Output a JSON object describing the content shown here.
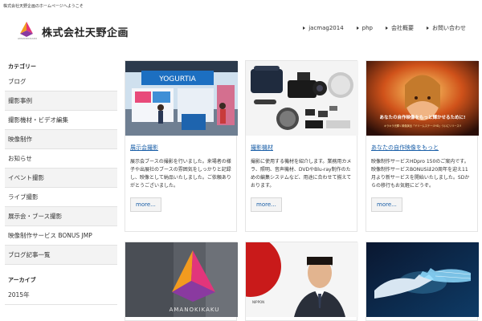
{
  "top_tagline": "株式会社天野企画のホームページへようこそ",
  "logo": {
    "small_text": "AMANOKIKAKU",
    "text": "株式会社天野企画"
  },
  "nav": [
    {
      "label": "jacmag2014"
    },
    {
      "label": "php"
    },
    {
      "label": "会社概要"
    },
    {
      "label": "お問い合わせ"
    }
  ],
  "sidebar": {
    "heading1": "カテゴリー",
    "items": [
      {
        "label": "ブログ"
      },
      {
        "label": "撮影事例"
      },
      {
        "label": "撮影機材・ビデオ編集"
      },
      {
        "label": "映像制作"
      },
      {
        "label": "お知らせ"
      },
      {
        "label": "イベント撮影"
      },
      {
        "label": "ライブ撮影"
      },
      {
        "label": "展示会・ブース撮影"
      },
      {
        "label": "映像制作サービス BONUS JMP"
      },
      {
        "label": "ブログ記事一覧"
      }
    ],
    "heading2": "アーカイブ",
    "items2": [
      {
        "label": "2015年"
      }
    ]
  },
  "cards": [
    {
      "title": "展示会撮影",
      "excerpt": "展示会ブースの撮影を行いました。来場者の様子や出展社のブースの雰囲気をしっかりと記録し、映像として納品いたしました。ご依頼ありがとうございました。",
      "more": "more..."
    },
    {
      "title": "撮影機材",
      "excerpt": "撮影に使用する機材を紹介します。業務用カメラ、照明、音声機材、DVDやBlu-ray制作のための編集システムなど、用途に合わせて揃えております。",
      "more": "more..."
    },
    {
      "title": "あなたの自作映像をもっと",
      "excerpt": "映像制作サービスHDpro 150のご案内です。映像制作サービスBONUSは20周年を迎え11月より新サービスを開始いたしました。SDからの移行もお気軽にどうぞ。",
      "more": "more..."
    }
  ],
  "thumb_texts": {
    "yogurt_sign": "YOGURTIA",
    "promo_line1": "あなたの自作映像をもっと輝かせるために!",
    "promo_line2": "キラキラ光輝く映像演出「ドリームステージHD」ついにリリース!!",
    "logo_card_text": "AMANOKIKAKU",
    "flag_caption": "NIPPON"
  }
}
